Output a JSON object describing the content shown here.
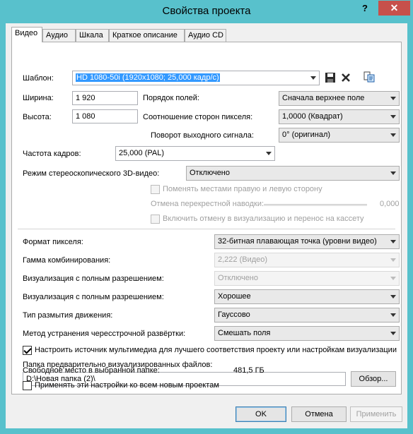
{
  "window": {
    "title": "Свойства проекта",
    "help_label": "?",
    "close_label": "✕"
  },
  "tabs": [
    {
      "label": "Видео",
      "active": true
    },
    {
      "label": "Аудио"
    },
    {
      "label": "Шкала"
    },
    {
      "label": "Краткое описание"
    },
    {
      "label": "Аудио CD"
    }
  ],
  "template": {
    "label": "Шаблон:",
    "value": "HD 1080-50i (1920x1080; 25,000 кадр/с)",
    "icons": [
      "save-icon",
      "delete-icon",
      "copy-settings-icon"
    ]
  },
  "width": {
    "label": "Ширина:",
    "value": "1 920"
  },
  "height": {
    "label": "Высота:",
    "value": "1 080"
  },
  "field_order": {
    "label": "Порядок полей:",
    "value": "Сначала верхнее поле"
  },
  "pixel_aspect": {
    "label": "Соотношение сторон пикселя:",
    "value": "1,0000 (Квадрат)"
  },
  "output_rotation": {
    "label": "Поворот выходного сигнала:",
    "value": "0° (оригинал)"
  },
  "frame_rate": {
    "label": "Частота кадров:",
    "value": "25,000 (PAL)"
  },
  "stereo3d": {
    "label": "Режим стереоскопического 3D-видео:",
    "value": "Отключено"
  },
  "swap_lr": {
    "label": "Поменять местами правую и левую сторону",
    "checked": false
  },
  "crosstalk": {
    "label": "Отмена перекрестной наводки:",
    "value": "0,000"
  },
  "cancel_render": {
    "label": "Включить отмену в визуализацию и перенос на кассету",
    "checked": false
  },
  "pixel_format": {
    "label": "Формат пикселя:",
    "value": "32-битная плавающая точка (уровни видео)"
  },
  "compositing_gamma": {
    "label": "Гамма комбинирования:",
    "value": "2,222 (Видео)"
  },
  "full_res_1": {
    "label": "Визуализация с полным разрешением:",
    "value": "Отключено"
  },
  "full_res_2": {
    "label": "Визуализация с полным разрешением:",
    "value": "Хорошее"
  },
  "motion_blur": {
    "label": "Тип размытия движения:",
    "value": "Гауссово"
  },
  "deinterlace": {
    "label": "Метод устранения чересстрочной развёртки:",
    "value": "Смешать поля"
  },
  "adjust_source": {
    "label": "Настроить источник мультимедиа для лучшего соответствия проекту или настройкам визуализации",
    "checked": true
  },
  "prerender_folder": {
    "label": "Папка предварительно визуализированных файлов:",
    "value": "D:\\Новая папка (2)\\",
    "browse_label": "Обзор..."
  },
  "free_space": {
    "label": "Свободное место в выбранной папке:",
    "value": "481,5 ГБ"
  },
  "apply_all": {
    "label": "Применять эти настройки ко всем новым проектам",
    "checked": false
  },
  "buttons": {
    "ok": "OK",
    "cancel": "Отмена",
    "apply": "Применить"
  }
}
